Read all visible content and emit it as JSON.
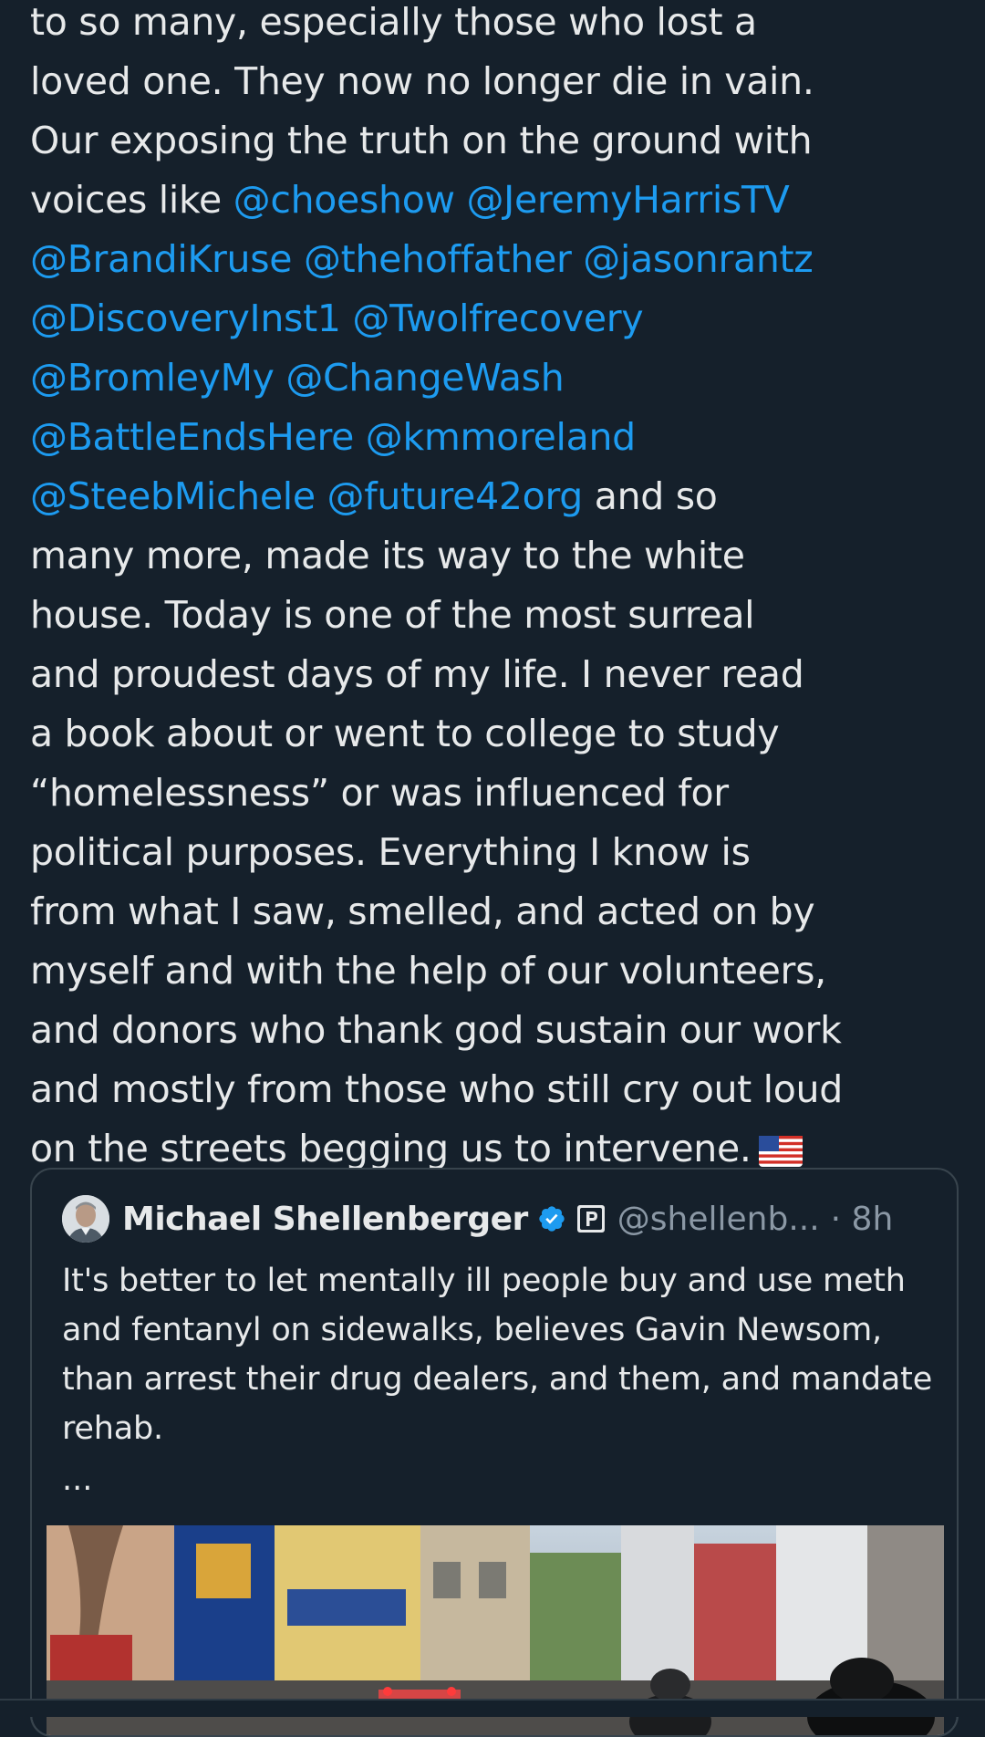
{
  "tweet": {
    "lines": [
      [
        {
          "t": "to so many, especially those who lost a"
        }
      ],
      [
        {
          "t": "loved one. They now no longer die in vain."
        }
      ],
      [
        {
          "t": "Our exposing the truth on the ground with"
        }
      ],
      [
        {
          "t": "voices like "
        },
        {
          "m": "@choeshow"
        },
        {
          "t": " "
        },
        {
          "m": "@JeremyHarrisTV"
        }
      ],
      [
        {
          "m": "@BrandiKruse"
        },
        {
          "t": " "
        },
        {
          "m": "@thehoffather"
        },
        {
          "t": " "
        },
        {
          "m": "@jasonrantz"
        }
      ],
      [
        {
          "m": "@DiscoveryInst1"
        },
        {
          "t": " "
        },
        {
          "m": "@Twolfrecovery"
        }
      ],
      [
        {
          "m": "@BromleyMy"
        },
        {
          "t": " "
        },
        {
          "m": "@ChangeWash"
        }
      ],
      [
        {
          "m": "@BattleEndsHere"
        },
        {
          "t": " "
        },
        {
          "m": "@kmmoreland"
        }
      ],
      [
        {
          "m": "@SteebMichele"
        },
        {
          "t": " "
        },
        {
          "m": "@future42org"
        },
        {
          "t": " and so"
        }
      ],
      [
        {
          "t": "many more, made its way to the white"
        }
      ],
      [
        {
          "t": "house. Today is one of the most surreal"
        }
      ],
      [
        {
          "t": "and proudest days of my life. I never read"
        }
      ],
      [
        {
          "t": "a book about or went to college to study"
        }
      ],
      [
        {
          "t": "“homelessness” or was influenced for"
        }
      ],
      [
        {
          "t": "political purposes.  Everything  I know is"
        }
      ],
      [
        {
          "t": "from what I saw, smelled, and acted on by"
        }
      ],
      [
        {
          "t": "myself and with the help of our volunteers,"
        }
      ],
      [
        {
          "t": "and donors who thank god sustain our work"
        }
      ],
      [
        {
          "t": "and mostly from those who still cry out loud"
        }
      ],
      [
        {
          "t": "on the streets begging us to intervene."
        }
      ]
    ],
    "trailing_icon": "us-flag-emoji"
  },
  "quote": {
    "author_name": "Michael Shellenberger",
    "verified_icon": "verified-badge-icon",
    "affiliation_icon": "parking-affiliation-icon",
    "handle": "@shellenb...",
    "time": "· 8h",
    "text": "It's better to let mentally ill people buy and use meth and fentanyl on sidewalks, believes Gavin Newsom, than arrest their drug dealers, and them, and mandate rehab.",
    "more": "...",
    "media_icon": "street-scene-video-thumbnail"
  },
  "colors": {
    "background": "#15202b",
    "text": "#e7e9ea",
    "mention": "#1d9bf0",
    "secondary": "#8b98a5",
    "border": "#38444d"
  }
}
